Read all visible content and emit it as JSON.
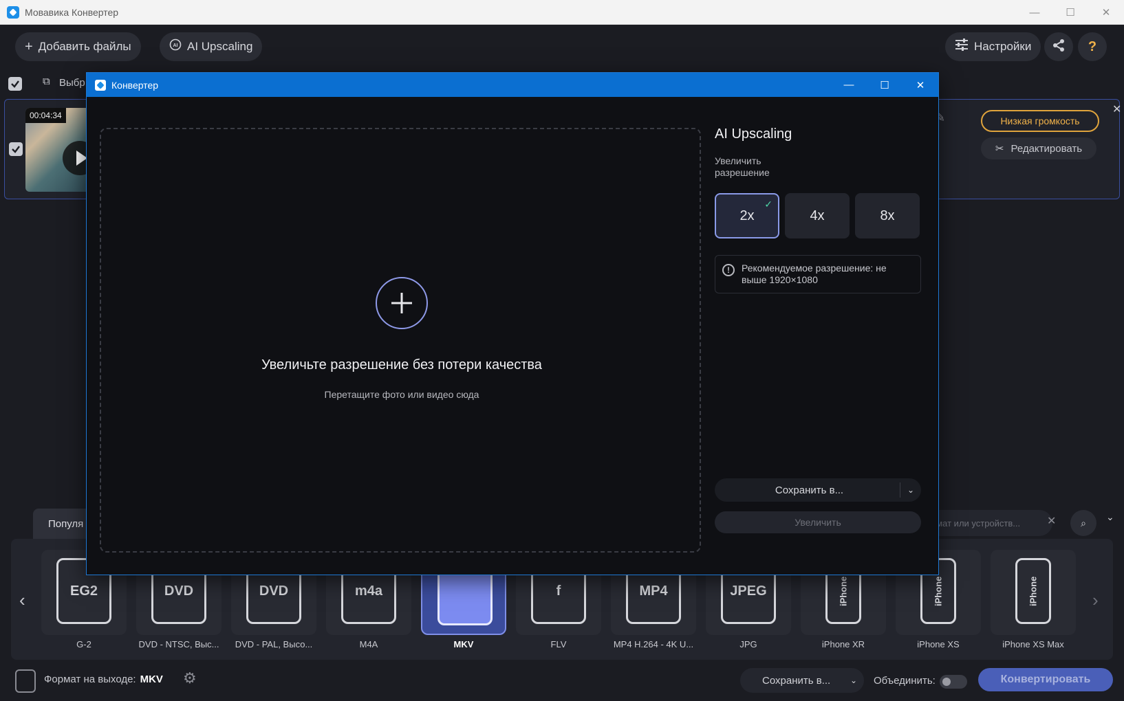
{
  "window": {
    "title": "Мовавика Конвертер",
    "minimize": "—",
    "maximize": "☐",
    "close": "✕"
  },
  "toolbar": {
    "add_files_label": "Добавить файлы",
    "ai_upscaling_label": "AI Upscaling",
    "settings_label": "Настройки",
    "help_label": "?"
  },
  "subbar": {
    "select_label": "Выбр"
  },
  "file": {
    "duration": "00:04:34",
    "volume_badge": "Низкая громкость",
    "edit_label": "Редактировать"
  },
  "formats": {
    "tab_popular": "Популя",
    "search_placeholder": "рмат или устройств...",
    "items": [
      {
        "label": "G-2",
        "icon_text": "EG2",
        "selected": false
      },
      {
        "label": "DVD - NTSC, Выс...",
        "icon_text": "DVD",
        "selected": false
      },
      {
        "label": "DVD - PAL, Высо...",
        "icon_text": "DVD",
        "selected": false
      },
      {
        "label": "M4A",
        "icon_text": "m4a",
        "selected": false
      },
      {
        "label": "MKV",
        "icon_text": "",
        "selected": true
      },
      {
        "label": "FLV",
        "icon_text": "f",
        "selected": false
      },
      {
        "label": "MP4 H.264 - 4K U...",
        "icon_text": "MP4",
        "selected": false
      },
      {
        "label": "JPG",
        "icon_text": "JPEG",
        "selected": false
      },
      {
        "label": "iPhone XR",
        "icon_text": "iPhone",
        "selected": false
      },
      {
        "label": "iPhone XS",
        "icon_text": "iPhone",
        "selected": false
      },
      {
        "label": "iPhone XS Max",
        "icon_text": "iPhone",
        "selected": false
      }
    ]
  },
  "footer": {
    "output_format_label": "Формат на выходе:",
    "output_format_value": "MKV",
    "save_to_label": "Сохранить в...",
    "merge_label": "Объединить:",
    "convert_label": "Конвертировать"
  },
  "dialog": {
    "title": "Конвертер",
    "dropzone_title": "Увеличьте разрешение без потери качества",
    "dropzone_subtitle": "Перетащите фото или видео сюда",
    "panel_title": "AI Upscaling",
    "panel_subtitle": "Увеличить разрешение",
    "scales": [
      "2x",
      "4x",
      "8x"
    ],
    "active_scale": "2x",
    "check_mark": "✓",
    "info_icon": "!",
    "info_text": "Рекомендуемое разрешение: не выше 1920×1080",
    "save_to_label": "Сохранить в...",
    "upscale_label": "Увеличить"
  },
  "colors": {
    "accent": "#0b6fd1",
    "selected_border": "#8a9ae8",
    "check": "#4fd9a8",
    "warning_pill": "#e0a43c"
  }
}
